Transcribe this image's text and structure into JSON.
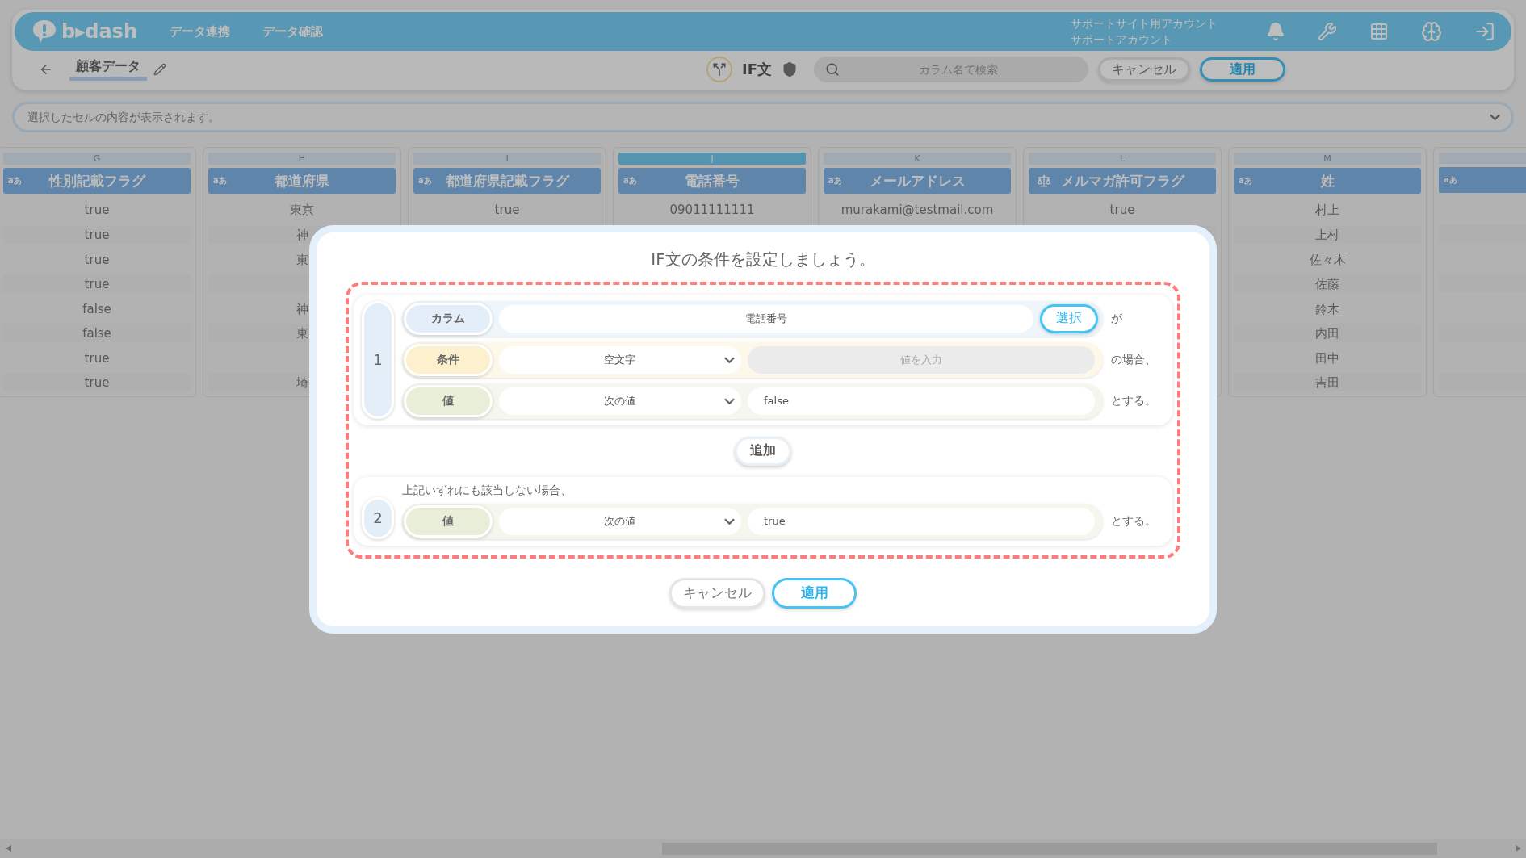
{
  "header": {
    "logo": "b▸dash",
    "nav": [
      {
        "label": "データ連携"
      },
      {
        "label": "データ確認"
      }
    ],
    "account": [
      "サポートサイト用アカウント",
      "サポートアカウント"
    ]
  },
  "toolbar": {
    "title": "顧客データ",
    "mode": "IF文",
    "search": {
      "placeholder": "カラム名で検索"
    },
    "buttons": [
      {
        "label": "キャンセル",
        "kind": "plain"
      },
      {
        "label": "適用",
        "kind": "primary"
      }
    ]
  },
  "cell_bar": {
    "placeholder": "選択したセルの内容が表示されます。"
  },
  "columns": [
    {
      "letter": "G",
      "title": "性別記載フラグ",
      "kind": "text",
      "badge": "aあ",
      "selected": false,
      "cells": [
        "true",
        "true",
        "true",
        "true",
        "false",
        "false",
        "true",
        "true"
      ]
    },
    {
      "letter": "H",
      "title": "都道府県",
      "kind": "text",
      "badge": "aあ",
      "selected": false,
      "cells": [
        "東京",
        "神",
        "東",
        null,
        "神",
        "東",
        null,
        "埼"
      ]
    },
    {
      "letter": "I",
      "title": "都道府県記載フラグ",
      "kind": "text",
      "badge": "aあ",
      "selected": false,
      "cells": [
        "true"
      ]
    },
    {
      "letter": "J",
      "title": "電話番号",
      "kind": "text",
      "badge": "aあ",
      "selected": true,
      "cells": [
        "09011111111"
      ]
    },
    {
      "letter": "K",
      "title": "メールアドレス",
      "kind": "text",
      "badge": "aあ",
      "selected": false,
      "cells": [
        "murakami@testmail.com"
      ]
    },
    {
      "letter": "L",
      "title": "メルマガ許可フラグ",
      "kind": "flag",
      "selected": false,
      "cells": [
        "true"
      ]
    },
    {
      "letter": "M",
      "title": "姓",
      "kind": "text",
      "badge": "aあ",
      "selected": false,
      "cells": [
        "村上",
        "上村",
        "佐々木",
        "佐藤",
        "鈴木",
        "内田",
        "田中",
        "吉田"
      ]
    },
    {
      "kind": "text",
      "badge": "aあ",
      "selected": false
    }
  ],
  "dialog": {
    "title": "IF文の条件を設定しましょう。",
    "conditions": [
      {
        "number": "1",
        "rows": [
          {
            "kind": "column",
            "label": "カラム",
            "value": "電話番号",
            "button": "選択",
            "suffix": "が"
          },
          {
            "kind": "condition",
            "label": "条件",
            "select": "空文字",
            "input": {
              "placeholder": "値を入力",
              "disabled": true
            },
            "suffix": "の場合、"
          },
          {
            "kind": "value",
            "label": "値",
            "select": "次の値",
            "input": {
              "value": "false",
              "disabled": false
            },
            "suffix": "とする。"
          }
        ]
      }
    ],
    "add_button": "追加",
    "otherwise": {
      "number": "2",
      "note": "上記いずれにも該当しない場合、",
      "rows": [
        {
          "kind": "value",
          "label": "値",
          "select": "次の値",
          "input": {
            "value": "true",
            "disabled": false
          },
          "suffix": "とする。"
        }
      ]
    },
    "buttons": [
      {
        "label": "キャンセル",
        "kind": "plain"
      },
      {
        "label": "適用",
        "kind": "primary"
      }
    ]
  }
}
